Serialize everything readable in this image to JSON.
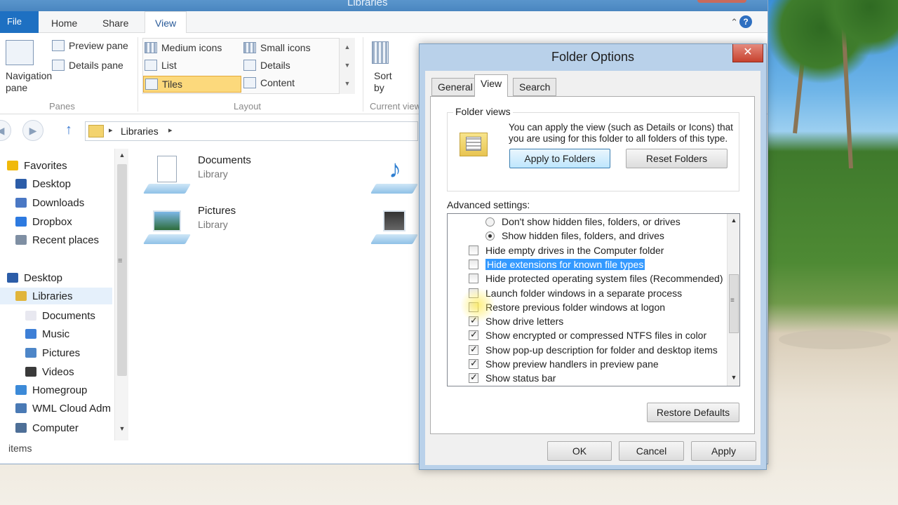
{
  "explorer": {
    "window_title": "Libraries",
    "tabs": {
      "file": "File",
      "home": "Home",
      "share": "Share",
      "view": "View"
    },
    "ribbon": {
      "panes": {
        "navigation_pane": "Navigation pane",
        "preview_pane": "Preview pane",
        "details_pane": "Details pane",
        "group": "Panes"
      },
      "layout": {
        "medium_icons": "Medium icons",
        "small_icons": "Small icons",
        "list": "List",
        "details": "Details",
        "tiles": "Tiles",
        "content": "Content",
        "group": "Layout"
      },
      "current_view": {
        "sort_by": "Sort by",
        "group": "Current view"
      }
    },
    "address": {
      "crumb": "Libraries"
    },
    "nav": [
      {
        "label": "Favorites",
        "icon": "star-icon"
      },
      {
        "label": "Desktop",
        "icon": "desktop-icon"
      },
      {
        "label": "Downloads",
        "icon": "downloads-icon"
      },
      {
        "label": "Dropbox",
        "icon": "dropbox-icon"
      },
      {
        "label": "Recent places",
        "icon": "recent-places-icon"
      },
      {
        "label": "Desktop",
        "icon": "desktop-icon"
      },
      {
        "label": "Libraries",
        "icon": "libraries-icon"
      },
      {
        "label": "Documents",
        "icon": "documents-icon"
      },
      {
        "label": "Music",
        "icon": "music-icon"
      },
      {
        "label": "Pictures",
        "icon": "pictures-icon"
      },
      {
        "label": "Videos",
        "icon": "videos-icon"
      },
      {
        "label": "Homegroup",
        "icon": "homegroup-icon"
      },
      {
        "label": "WML Cloud Adm",
        "icon": "cloud-icon"
      },
      {
        "label": "Computer",
        "icon": "computer-icon"
      }
    ],
    "libraries": [
      {
        "name": "Documents",
        "type": "Library"
      },
      {
        "name": "Pictures",
        "type": "Library"
      }
    ],
    "status": "items"
  },
  "dialog": {
    "title": "Folder Options",
    "tabs": {
      "general": "General",
      "view": "View",
      "search": "Search"
    },
    "folder_views": {
      "legend": "Folder views",
      "description": "You can apply the view (such as Details or Icons) that you are using for this folder to all folders of this type.",
      "apply_button": "Apply to Folders",
      "reset_button": "Reset Folders"
    },
    "advanced_label": "Advanced settings:",
    "advanced": [
      {
        "type": "radio",
        "checked": false,
        "label": "Don't show hidden files, folders, or drives"
      },
      {
        "type": "radio",
        "checked": true,
        "label": "Show hidden files, folders, and drives"
      },
      {
        "type": "checkbox",
        "checked": false,
        "label": "Hide empty drives in the Computer folder"
      },
      {
        "type": "checkbox",
        "checked": false,
        "label": "Hide extensions for known file types",
        "highlighted": true
      },
      {
        "type": "checkbox",
        "checked": false,
        "label": "Hide protected operating system files (Recommended)"
      },
      {
        "type": "checkbox",
        "checked": false,
        "label": "Launch folder windows in a separate process"
      },
      {
        "type": "checkbox",
        "checked": false,
        "label": "Restore previous folder windows at logon"
      },
      {
        "type": "checkbox",
        "checked": true,
        "label": "Show drive letters"
      },
      {
        "type": "checkbox",
        "checked": true,
        "label": "Show encrypted or compressed NTFS files in color"
      },
      {
        "type": "checkbox",
        "checked": true,
        "label": "Show pop-up description for folder and desktop items"
      },
      {
        "type": "checkbox",
        "checked": true,
        "label": "Show preview handlers in preview pane"
      },
      {
        "type": "checkbox",
        "checked": true,
        "label": "Show status bar"
      }
    ],
    "restore_defaults": "Restore Defaults",
    "ok": "OK",
    "cancel": "Cancel",
    "apply": "Apply",
    "close_glyph": "✕"
  }
}
